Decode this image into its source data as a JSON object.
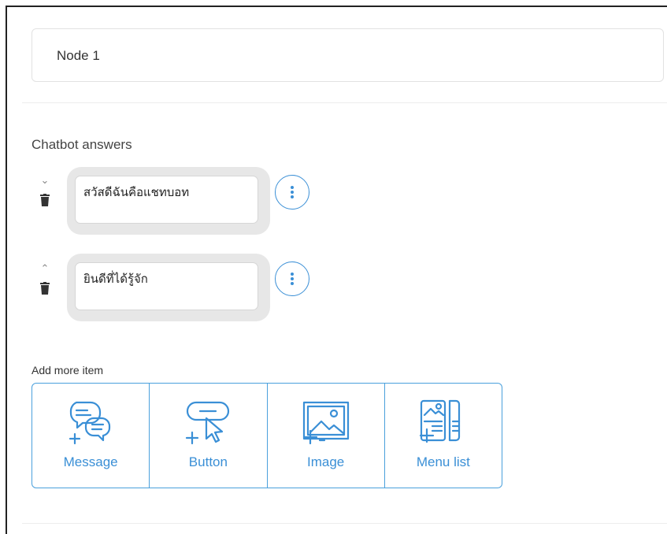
{
  "node": {
    "title": "Node 1"
  },
  "answers": {
    "section_label": "Chatbot answers",
    "items": [
      {
        "text": "สวัสดีฉันคือแชทบอท",
        "toggle_icon": "chevron-down-icon"
      },
      {
        "text": "ยินดีที่ได้รู้จัก",
        "toggle_icon": "chevron-up-icon"
      }
    ]
  },
  "add_more": {
    "label": "Add more item",
    "items": [
      {
        "label": "Message",
        "icon": "message-icon"
      },
      {
        "label": "Button",
        "icon": "button-icon"
      },
      {
        "label": "Image",
        "icon": "image-icon"
      },
      {
        "label": "Menu list",
        "icon": "menu-list-icon"
      }
    ]
  },
  "colors": {
    "accent": "#3a8fd6",
    "border": "#4aa0dc"
  }
}
